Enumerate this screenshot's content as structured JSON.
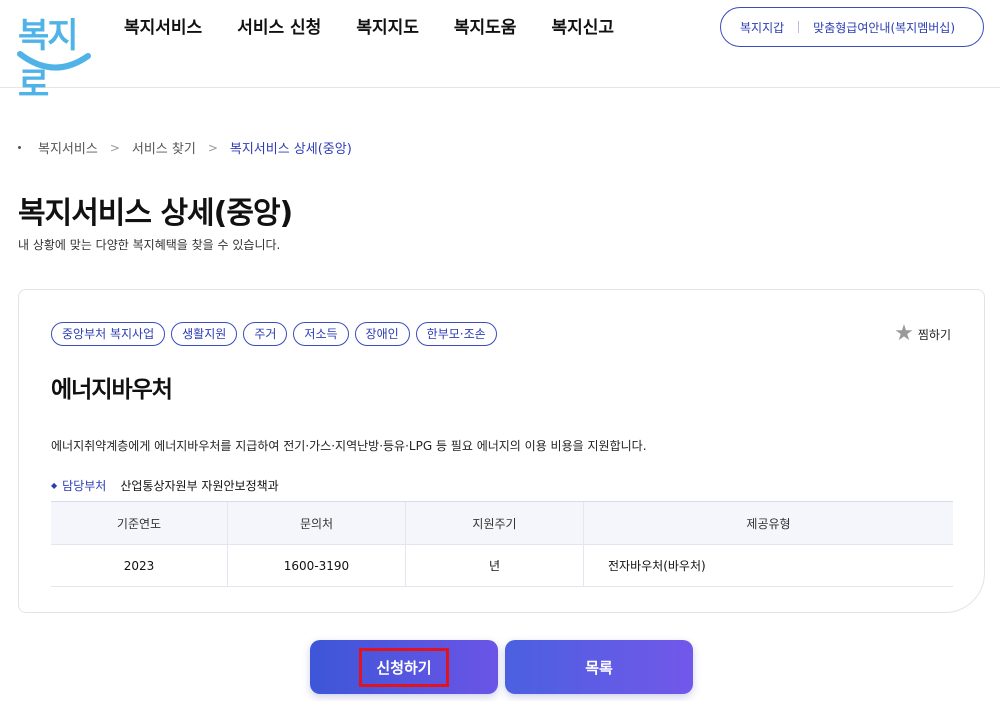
{
  "header": {
    "logo_text": "복지로",
    "nav": [
      "복지서비스",
      "서비스 신청",
      "복지지도",
      "복지도움",
      "복지신고"
    ],
    "util_links": [
      "복지지갑",
      "맞춤형급여안내(복지멤버십)"
    ]
  },
  "breadcrumb": [
    "복지서비스",
    "서비스 찾기",
    "복지서비스 상세(중앙)"
  ],
  "page": {
    "title": "복지서비스 상세(중앙)",
    "subtitle": "내 상황에 맞는 다양한 복지혜택을 찾을 수 있습니다."
  },
  "service": {
    "tags": [
      "중앙부처 복지사업",
      "생활지원",
      "주거",
      "저소득",
      "장애인",
      "한부모·조손"
    ],
    "favorite_label": "찜하기",
    "title": "에너지바우처",
    "description": "에너지취약계층에게 에너지바우처를 지급하여 전기·가스·지역난방·등유·LPG 등 필요 에너지의 이용 비용을 지원합니다.",
    "dept_label": "담당부처",
    "dept_value": "산업통상자원부 자원안보정책과",
    "table": {
      "headers": [
        "기준연도",
        "문의처",
        "지원주기",
        "제공유형"
      ],
      "row": [
        "2023",
        "1600-3190",
        "년",
        "전자바우처(바우처)"
      ]
    }
  },
  "buttons": {
    "apply": "신청하기",
    "list": "목록"
  },
  "colors": {
    "accent": "#2b3db3",
    "logo": "#4fb3e8",
    "highlight": "#e0141e"
  }
}
